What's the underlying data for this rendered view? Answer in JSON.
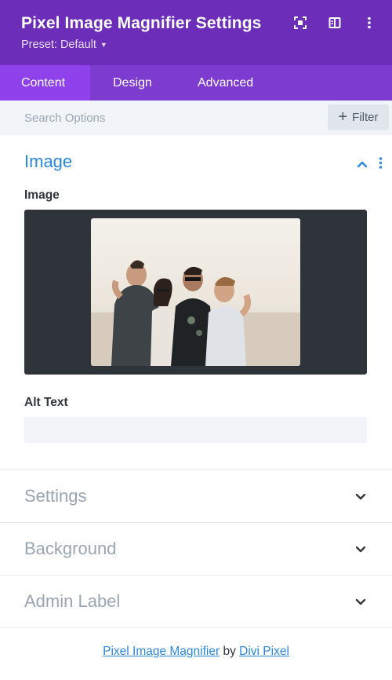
{
  "header": {
    "title": "Pixel Image Magnifier Settings",
    "preset": "Preset: Default",
    "icons": [
      "focus-icon",
      "sidebar-layout-icon",
      "more-vertical-icon"
    ]
  },
  "tabs": [
    {
      "label": "Content",
      "active": true
    },
    {
      "label": "Design",
      "active": false
    },
    {
      "label": "Advanced",
      "active": false
    }
  ],
  "search": {
    "placeholder": "Search Options",
    "filter_label": "Filter"
  },
  "image_section": {
    "title": "Image",
    "image_label": "Image",
    "alt_label": "Alt Text",
    "alt_value": ""
  },
  "collapsed_sections": [
    {
      "title": "Settings"
    },
    {
      "title": "Background"
    },
    {
      "title": "Admin Label"
    }
  ],
  "footer": {
    "product": "Pixel Image Magnifier",
    "by": "by",
    "author": "Divi Pixel"
  },
  "colors": {
    "header_bg": "#6c2eb9",
    "tabs_bg": "#7e3bd0",
    "active_tab_bg": "#8f42ec",
    "accent_blue": "#2b87da"
  }
}
